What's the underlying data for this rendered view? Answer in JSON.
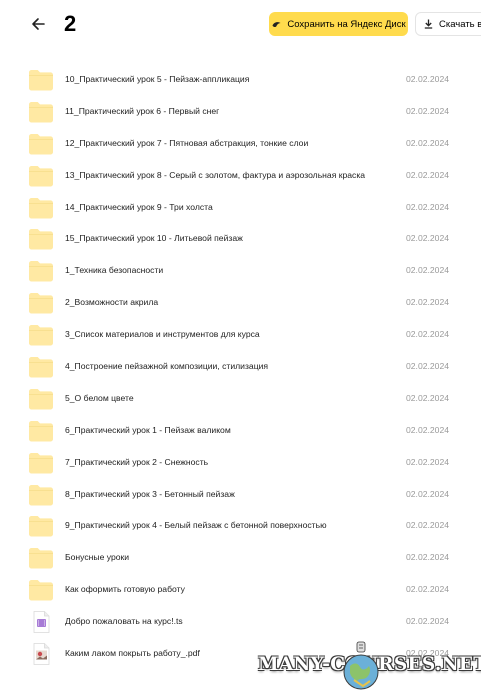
{
  "header": {
    "title": "2",
    "save_label": "Сохранить на Яндекс Диск",
    "download_label": "Скачать всё"
  },
  "files": [
    {
      "name": "10_Практический урок 5 - Пейзаж-аппликация",
      "date": "02.02.2024",
      "type": "folder"
    },
    {
      "name": "11_Практический урок 6 - Первый снег",
      "date": "02.02.2024",
      "type": "folder"
    },
    {
      "name": "12_Практический урок 7 - Пятновая абстракция, тонкие слои",
      "date": "02.02.2024",
      "type": "folder"
    },
    {
      "name": "13_Практический урок 8 - Серый с золотом, фактура и аэрозольная краска",
      "date": "02.02.2024",
      "type": "folder"
    },
    {
      "name": "14_Практический урок 9 - Три холста",
      "date": "02.02.2024",
      "type": "folder"
    },
    {
      "name": "15_Практический урок 10 - Литьевой пейзаж",
      "date": "02.02.2024",
      "type": "folder"
    },
    {
      "name": "1_Техника безопасности",
      "date": "02.02.2024",
      "type": "folder"
    },
    {
      "name": "2_Возможности акрила",
      "date": "02.02.2024",
      "type": "folder"
    },
    {
      "name": "3_Список материалов и инструментов для курса",
      "date": "02.02.2024",
      "type": "folder"
    },
    {
      "name": "4_Построение пейзажной композиции, стилизация",
      "date": "02.02.2024",
      "type": "folder"
    },
    {
      "name": "5_О белом цвете",
      "date": "02.02.2024",
      "type": "folder"
    },
    {
      "name": "6_Практический урок 1 - Пейзаж валиком",
      "date": "02.02.2024",
      "type": "folder"
    },
    {
      "name": "7_Практический урок 2 - Снежность",
      "date": "02.02.2024",
      "type": "folder"
    },
    {
      "name": "8_Практический урок 3 - Бетонный пейзаж",
      "date": "02.02.2024",
      "type": "folder"
    },
    {
      "name": "9_Практический урок 4 - Белый пейзаж с бетонной поверхностью",
      "date": "02.02.2024",
      "type": "folder"
    },
    {
      "name": "Бонусные уроки",
      "date": "02.02.2024",
      "type": "folder"
    },
    {
      "name": "Как оформить готовую работу",
      "date": "02.02.2024",
      "type": "folder"
    },
    {
      "name": "Добро пожаловать на курс!.ts",
      "date": "02.02.2024",
      "type": "video"
    },
    {
      "name": "Каким лаком покрыть работу_.pdf",
      "date": "02.02.2024",
      "type": "pdf"
    }
  ],
  "watermark": {
    "text": "MANY-COURSES.NET"
  },
  "colors": {
    "accent": "#ffdb4d",
    "folder": "#ffe9a3",
    "date": "#9a9a9a"
  },
  "icons": {
    "back": "arrow-left-icon",
    "save": "yandex-disk-icon",
    "download": "download-icon",
    "folder": "folder-icon",
    "video": "video-file-icon",
    "pdf": "pdf-file-icon"
  }
}
